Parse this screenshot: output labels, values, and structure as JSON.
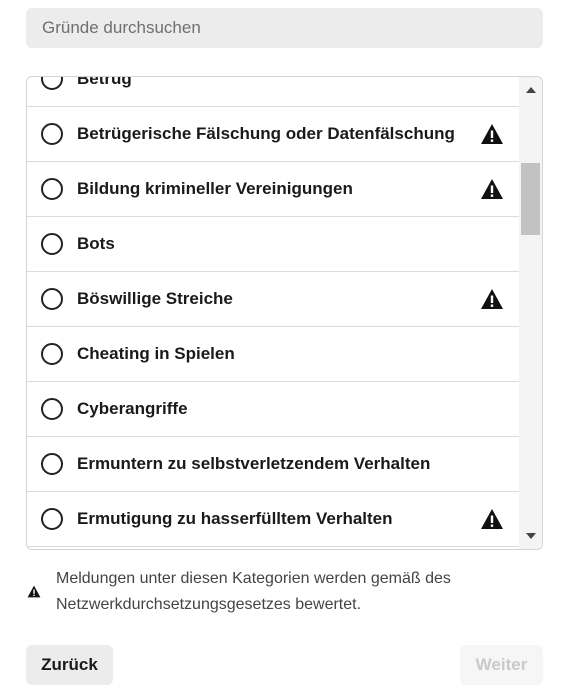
{
  "search": {
    "placeholder": "Gründe durchsuchen",
    "value": ""
  },
  "reasons": [
    {
      "label": "Betrug",
      "warning": false
    },
    {
      "label": "Betrügerische Fälschung oder Datenfälschung",
      "warning": true
    },
    {
      "label": "Bildung krimineller Vereinigungen",
      "warning": true
    },
    {
      "label": "Bots",
      "warning": false
    },
    {
      "label": "Böswillige Streiche",
      "warning": true
    },
    {
      "label": "Cheating in Spielen",
      "warning": false
    },
    {
      "label": "Cyberangriffe",
      "warning": false
    },
    {
      "label": "Ermuntern zu selbstverletzendem Verhalten",
      "warning": false
    },
    {
      "label": "Ermutigung zu hasserfülltem Verhalten",
      "warning": true
    }
  ],
  "note": {
    "text": "Meldungen unter diesen Kategorien werden gemäß des Netzwerkdurchsetzungsgesetzes bewertet.",
    "icon": "warning-icon"
  },
  "buttons": {
    "back": "Zurück",
    "next": "Weiter"
  },
  "colors": {
    "button_bg": "#ececec",
    "disabled_text": "#c9c9c9",
    "scroll_thumb": "#c2c2c2"
  }
}
